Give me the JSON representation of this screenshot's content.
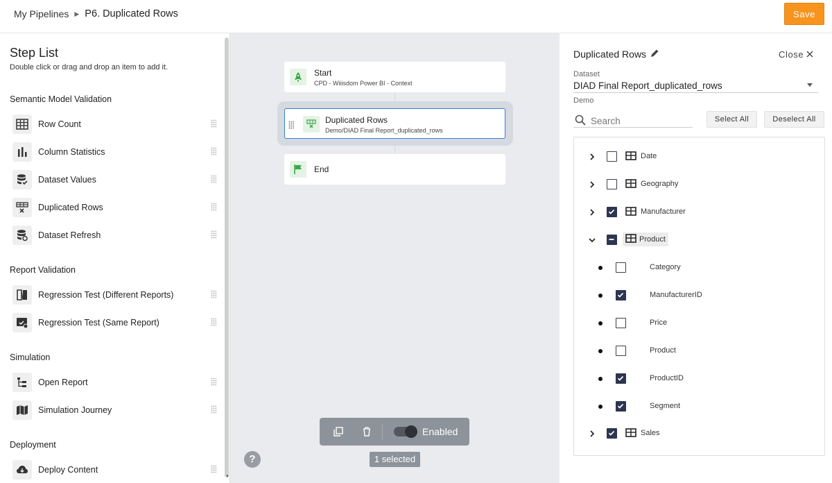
{
  "header": {
    "breadcrumb_root": "My Pipelines",
    "breadcrumb_current": "P6. Duplicated Rows",
    "save_label": "Save"
  },
  "sidebar": {
    "title": "Step List",
    "subtitle": "Double click or drag and drop an item to add it.",
    "sections": {
      "semantic": "Semantic Model Validation",
      "report": "Report Validation",
      "simulation": "Simulation",
      "deployment": "Deployment"
    },
    "items": [
      {
        "label": "Row Count",
        "icon": "table-icon"
      },
      {
        "label": "Column Statistics",
        "icon": "bar-chart-icon"
      },
      {
        "label": "Dataset Values",
        "icon": "database-check-icon"
      },
      {
        "label": "Duplicated Rows",
        "icon": "duplicate-rows-icon"
      },
      {
        "label": "Dataset Refresh",
        "icon": "database-refresh-icon"
      },
      {
        "label": "Regression Test (Different Reports)",
        "icon": "compare-reports-icon"
      },
      {
        "label": "Regression Test (Same Report)",
        "icon": "report-check-icon"
      },
      {
        "label": "Open Report",
        "icon": "tree-icon"
      },
      {
        "label": "Simulation Journey",
        "icon": "map-icon"
      },
      {
        "label": "Deploy Content",
        "icon": "cloud-download-icon"
      }
    ]
  },
  "canvas": {
    "nodes": [
      {
        "title": "Start",
        "subtitle": "CPD - Wiiisdom Power BI - Context",
        "icon": "rocket-icon"
      },
      {
        "title": "Duplicated Rows",
        "subtitle": "Demo/DIAD Final Report_duplicated_rows",
        "icon": "duplicate-rows-icon"
      },
      {
        "title": "End",
        "subtitle": "",
        "icon": "flag-icon"
      }
    ],
    "toolbar": {
      "enabled_label": "Enabled",
      "enabled": true
    },
    "selected_count": "1 selected",
    "help_label": "?"
  },
  "panel": {
    "title": "Duplicated Rows",
    "close_label": "Close",
    "dataset_label": "Dataset",
    "dataset_value": "DIAD Final Report_duplicated_rows",
    "workspace": "Demo",
    "search_placeholder": "Search",
    "select_all": "Select All",
    "deselect_all": "Deselect All",
    "tree": [
      {
        "label": "Date",
        "state": "unchecked",
        "expanded": false,
        "level": 0
      },
      {
        "label": "Geography",
        "state": "unchecked",
        "expanded": false,
        "level": 0
      },
      {
        "label": "Manufacturer",
        "state": "checked",
        "expanded": false,
        "level": 0
      },
      {
        "label": "Product",
        "state": "indeterminate",
        "expanded": true,
        "level": 0
      },
      {
        "label": "Category",
        "state": "unchecked",
        "level": 1
      },
      {
        "label": "ManufacturerID",
        "state": "checked",
        "level": 1
      },
      {
        "label": "Price",
        "state": "unchecked",
        "level": 1
      },
      {
        "label": "Product",
        "state": "unchecked",
        "level": 1
      },
      {
        "label": "ProductID",
        "state": "checked",
        "level": 1
      },
      {
        "label": "Segment",
        "state": "checked",
        "level": 1
      },
      {
        "label": "Sales",
        "state": "checked",
        "expanded": false,
        "level": 0
      }
    ]
  }
}
